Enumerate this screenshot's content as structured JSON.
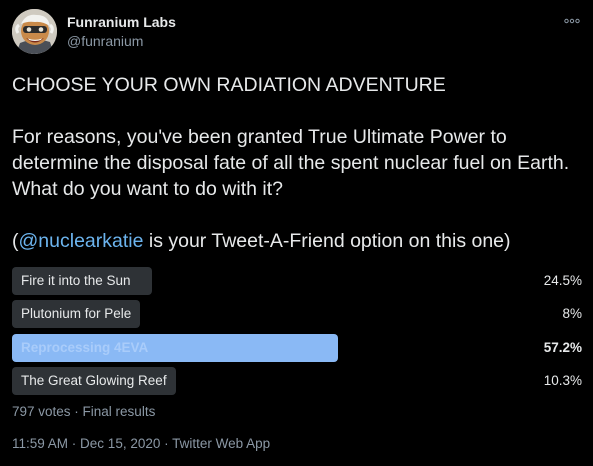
{
  "author": {
    "display_name": "Funranium Labs",
    "handle": "@funranium",
    "avatar_icon": "avatar-icon"
  },
  "tweet": {
    "line1": "CHOOSE YOUR OWN RADIATION ADVENTURE",
    "line2": "For reasons, you've been granted True Ultimate Power to determine the disposal fate of all the spent nuclear fuel on Earth. What do you want to do with it?",
    "line3_open": "(",
    "mention": "@nuclearkatie",
    "line3_rest": " is your Tweet-A-Friend option on this one)"
  },
  "poll": {
    "options": [
      {
        "label": "Fire it into the Sun",
        "percent": "24.5%",
        "fraction": 0.245,
        "leader": false
      },
      {
        "label": "Plutonium for Pele",
        "percent": "8%",
        "fraction": 0.08,
        "leader": false
      },
      {
        "label": "Reprocessing 4EVA",
        "percent": "57.2%",
        "fraction": 0.572,
        "leader": true
      },
      {
        "label": "The Great Glowing Reef",
        "percent": "10.3%",
        "fraction": 0.103,
        "leader": false
      }
    ],
    "votes": "797 votes",
    "separator": " · ",
    "status": "Final results"
  },
  "meta": {
    "time": "11:59 AM",
    "sep1": " · ",
    "date": "Dec 15, 2020",
    "sep2": " · ",
    "client": "Twitter Web App"
  },
  "colors": {
    "background": "#000000",
    "bar": "#2e3236",
    "leader_bar": "#8ab9f5",
    "link": "#6cb4ee",
    "muted": "#8b98a5"
  }
}
